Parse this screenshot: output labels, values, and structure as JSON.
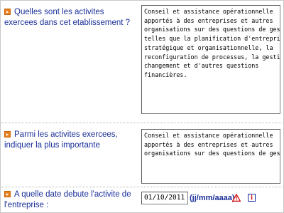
{
  "questions": [
    {
      "label": "Quelles sont les activites exercees dans cet etablissement ?",
      "answer": "Conseil et assistance opérationnelle\napportés à des entreprises et autres\norganisations sur des questions de gestion\ntelles que la planification d'entreprise\nstratégique et organisationnelle, la\nreconfiguration de processus, la gestion du\nchangement et d'autres questions\nfinancières."
    },
    {
      "label": "Parmi les activites exercees, indiquer la plus importante",
      "answer": "Conseil et assistance opérationnelle\napportés à des entreprises et autres\norganisations sur des questions de gestion"
    },
    {
      "label": "A quelle date debute l'activite de l'entreprise :",
      "value": "01/10/2011",
      "hint": "(jj/mm/aaaa)"
    }
  ],
  "icons": {
    "bullet": "orange-arrow-bullet-icon",
    "warning": "warning-triangle-icon",
    "info": "info-icon",
    "info_glyph": "i"
  },
  "colors": {
    "question_text": "#1a2f99",
    "bullet": "#e8821e",
    "warning": "#d40000"
  }
}
